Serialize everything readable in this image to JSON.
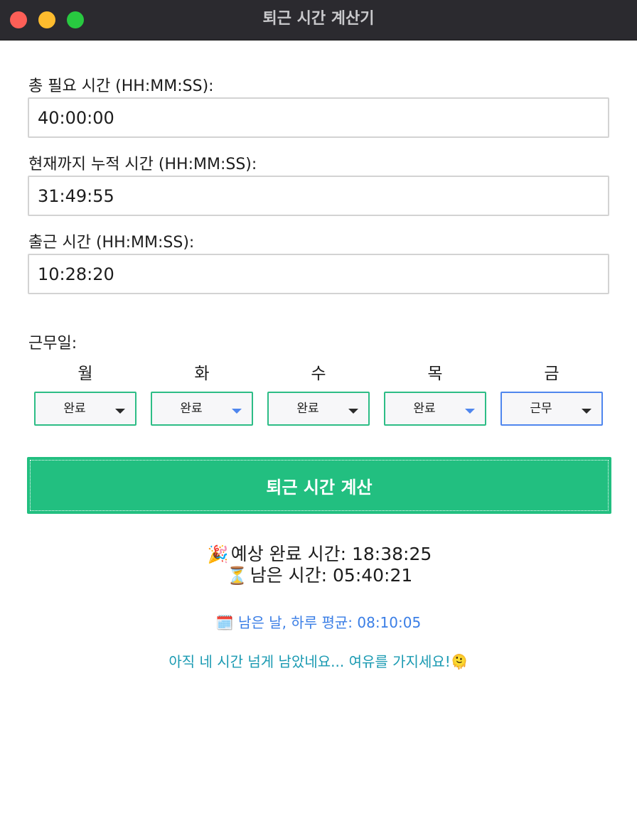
{
  "window": {
    "title": "퇴근 시간 계산기"
  },
  "fields": {
    "total": {
      "label": "총 필요 시간 (HH:MM:SS):",
      "value": "40:00:00"
    },
    "accumulated": {
      "label": "현재까지 누적 시간 (HH:MM:SS):",
      "value": "31:49:55"
    },
    "start": {
      "label": "출근 시간 (HH:MM:SS):",
      "value": "10:28:20"
    }
  },
  "workdays": {
    "label": "근무일:",
    "days": [
      {
        "name": "월",
        "status": "완료"
      },
      {
        "name": "화",
        "status": "완료"
      },
      {
        "name": "수",
        "status": "완료"
      },
      {
        "name": "목",
        "status": "완료"
      },
      {
        "name": "금",
        "status": "근무"
      }
    ]
  },
  "calculate_button": {
    "label": "퇴근 시간 계산"
  },
  "results": {
    "finish_icon": "🎉",
    "finish_text": "예상 완료 시간: 18:38:25",
    "remaining_icon": "⏳",
    "remaining_text": "남은 시간: 05:40:21",
    "average_icon": "🗓️",
    "average_text": "남은 날, 하루 평균: 08:10:05",
    "message_text": "아직 네 시간 넘게 남았네요... 여유를 가지세요!",
    "message_icon": "🫠"
  },
  "colors": {
    "accent_green": "#22bf80",
    "focus_blue": "#4f86ee",
    "average_blue": "#3a7ee6",
    "message_teal": "#1a9ab2",
    "titlebar": "#2b2a2f"
  }
}
